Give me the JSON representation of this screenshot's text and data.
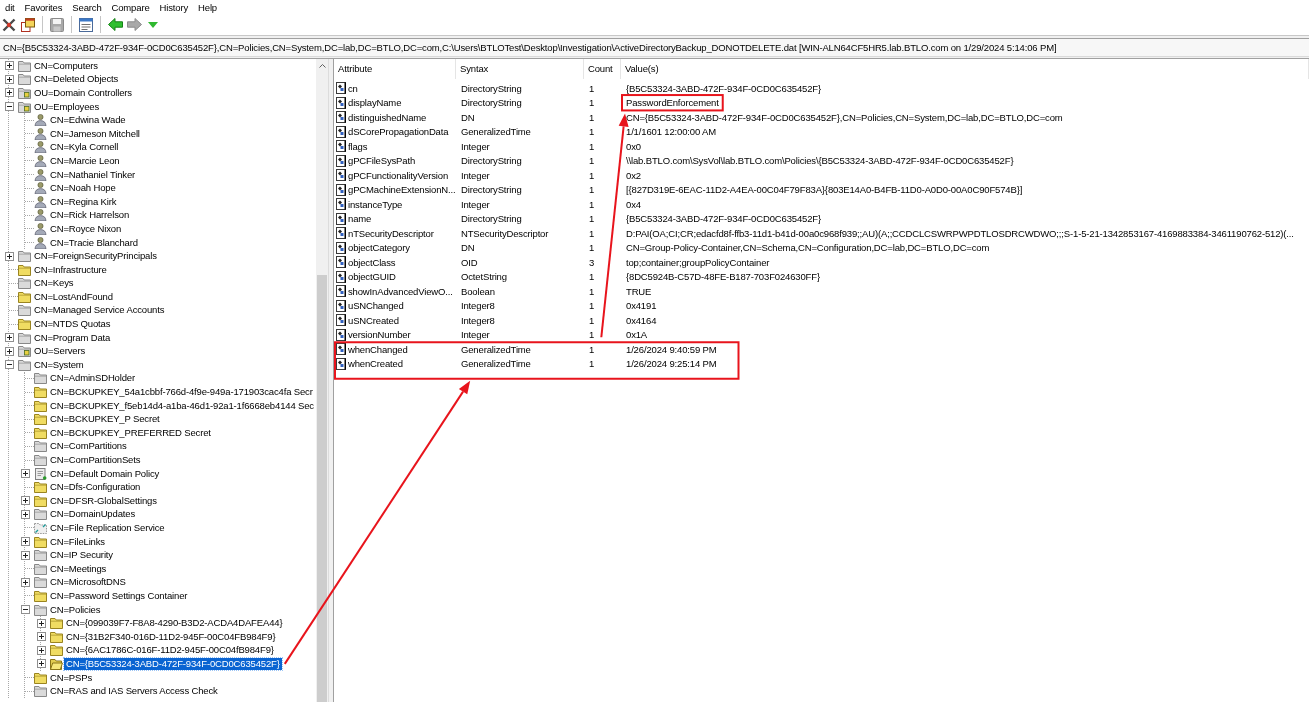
{
  "menu": [
    "dit",
    "Favorites",
    "Search",
    "Compare",
    "History",
    "Help"
  ],
  "toolbar": [
    [
      {
        "kind": "cross",
        "disabled": false
      },
      {
        "kind": "windows",
        "disabled": false
      }
    ],
    [
      {
        "kind": "save",
        "disabled": true
      }
    ],
    [
      {
        "kind": "properties",
        "disabled": false
      }
    ],
    [
      {
        "kind": "back",
        "disabled": false
      },
      {
        "kind": "forward",
        "disabled": true
      },
      {
        "kind": "history",
        "disabled": false
      }
    ]
  ],
  "path": "CN={B5C53324-3ABD-472F-934F-0CD0C635452F},CN=Policies,CN=System,DC=lab,DC=BTLO,DC=com,C:\\Users\\BTLOTest\\Desktop\\Investigation\\ActiveDirectoryBackup_DONOTDELETE.dat [WIN-ALN64CF5HR5.lab.BTLO.com on 1/29/2024 5:14:06 PM]",
  "tree": [
    {
      "label": "CN=Computers",
      "kind": "container",
      "expanded": false,
      "selected": false
    },
    {
      "label": "CN=Deleted Objects",
      "kind": "container",
      "expanded": false,
      "selected": false
    },
    {
      "label": "OU=Domain Controllers",
      "kind": "ou",
      "expanded": false,
      "selected": false
    },
    {
      "label": "OU=Employees",
      "kind": "ou",
      "expanded": true,
      "selected": false,
      "children": [
        {
          "label": "CN=Edwina Wade",
          "kind": "user",
          "selected": false
        },
        {
          "label": "CN=Jameson Mitchell",
          "kind": "user",
          "selected": false
        },
        {
          "label": "CN=Kyla Cornell",
          "kind": "user",
          "selected": false
        },
        {
          "label": "CN=Marcie Leon",
          "kind": "user",
          "selected": false
        },
        {
          "label": "CN=Nathaniel Tinker",
          "kind": "user",
          "selected": false
        },
        {
          "label": "CN=Noah Hope",
          "kind": "user",
          "selected": false
        },
        {
          "label": "CN=Regina Kirk",
          "kind": "user",
          "selected": false
        },
        {
          "label": "CN=Rick Harrelson",
          "kind": "user",
          "selected": false
        },
        {
          "label": "CN=Royce Nixon",
          "kind": "user",
          "selected": false
        },
        {
          "label": "CN=Tracie Blanchard",
          "kind": "user",
          "selected": false
        }
      ]
    },
    {
      "label": "CN=ForeignSecurityPrincipals",
      "kind": "container",
      "expanded": false,
      "selected": false
    },
    {
      "label": "CN=Infrastructure",
      "kind": "folder",
      "selected": false
    },
    {
      "label": "CN=Keys",
      "kind": "container",
      "selected": false
    },
    {
      "label": "CN=LostAndFound",
      "kind": "folder",
      "selected": false
    },
    {
      "label": "CN=Managed Service Accounts",
      "kind": "container",
      "selected": false
    },
    {
      "label": "CN=NTDS Quotas",
      "kind": "folder",
      "selected": false
    },
    {
      "label": "CN=Program Data",
      "kind": "container",
      "expanded": false,
      "selected": false
    },
    {
      "label": "OU=Servers",
      "kind": "ou",
      "expanded": false,
      "selected": false
    },
    {
      "label": "CN=System",
      "kind": "container",
      "expanded": true,
      "selected": false,
      "children": [
        {
          "label": "CN=AdminSDHolder",
          "kind": "container",
          "selected": false
        },
        {
          "label": "CN=BCKUPKEY_54a1cbbf-766d-4f9e-949a-171903cac4fa Secr",
          "kind": "folder",
          "selected": false
        },
        {
          "label": "CN=BCKUPKEY_f5eb14d4-a1ba-46d1-92a1-1f6668eb4144 Sec",
          "kind": "folder",
          "selected": false
        },
        {
          "label": "CN=BCKUPKEY_P Secret",
          "kind": "folder",
          "selected": false
        },
        {
          "label": "CN=BCKUPKEY_PREFERRED Secret",
          "kind": "folder",
          "selected": false
        },
        {
          "label": "CN=ComPartitions",
          "kind": "container",
          "selected": false
        },
        {
          "label": "CN=ComPartitionSets",
          "kind": "container",
          "selected": false
        },
        {
          "label": "CN=Default Domain Policy",
          "kind": "policy",
          "expanded": false,
          "selected": false
        },
        {
          "label": "CN=Dfs-Configuration",
          "kind": "folder",
          "selected": false
        },
        {
          "label": "CN=DFSR-GlobalSettings",
          "kind": "folder",
          "expanded": false,
          "selected": false
        },
        {
          "label": "CN=DomainUpdates",
          "kind": "container",
          "expanded": false,
          "selected": false
        },
        {
          "label": "CN=File Replication Service",
          "kind": "replication",
          "selected": false
        },
        {
          "label": "CN=FileLinks",
          "kind": "folder",
          "expanded": false,
          "selected": false
        },
        {
          "label": "CN=IP Security",
          "kind": "container",
          "expanded": false,
          "selected": false
        },
        {
          "label": "CN=Meetings",
          "kind": "container",
          "selected": false
        },
        {
          "label": "CN=MicrosoftDNS",
          "kind": "container",
          "expanded": false,
          "selected": false
        },
        {
          "label": "CN=Password Settings Container",
          "kind": "folder",
          "selected": false
        },
        {
          "label": "CN=Policies",
          "kind": "container",
          "expanded": true,
          "selected": false,
          "children": [
            {
              "label": "CN={099039F7-F8A8-4290-B3D2-ACDA4DAFEA44}",
              "kind": "folder",
              "expanded": false,
              "selected": false
            },
            {
              "label": "CN={31B2F340-016D-11D2-945F-00C04FB984F9}",
              "kind": "folder",
              "expanded": false,
              "selected": false
            },
            {
              "label": "CN={6AC1786C-016F-11D2-945F-00C04fB984F9}",
              "kind": "folder",
              "expanded": false,
              "selected": false
            },
            {
              "label": "CN={B5C53324-3ABD-472F-934F-0CD0C635452F}",
              "kind": "open_folder",
              "expanded": false,
              "selected": true
            }
          ]
        },
        {
          "label": "CN=PSPs",
          "kind": "folder",
          "selected": false
        },
        {
          "label": "CN=RAS and IAS Servers Access Check",
          "kind": "container",
          "selected": false
        }
      ]
    }
  ],
  "list": {
    "columns": [
      "Attribute",
      "Syntax",
      "Count",
      "Value(s)"
    ],
    "rows": [
      {
        "attribute": "cn",
        "syntax": "DirectoryString",
        "count": "1",
        "value": "{B5C53324-3ABD-472F-934F-0CD0C635452F}",
        "boxed": false,
        "value_boxed": false
      },
      {
        "attribute": "displayName",
        "syntax": "DirectoryString",
        "count": "1",
        "value": "PasswordEnforcement",
        "boxed": false,
        "value_boxed": true
      },
      {
        "attribute": "distinguishedName",
        "syntax": "DN",
        "count": "1",
        "value": "CN={B5C53324-3ABD-472F-934F-0CD0C635452F},CN=Policies,CN=System,DC=lab,DC=BTLO,DC=com",
        "boxed": false,
        "value_boxed": false
      },
      {
        "attribute": "dSCorePropagationData",
        "syntax": "GeneralizedTime",
        "count": "1",
        "value": "1/1/1601 12:00:00 AM",
        "boxed": false,
        "value_boxed": false
      },
      {
        "attribute": "flags",
        "syntax": "Integer",
        "count": "1",
        "value": "0x0",
        "boxed": false,
        "value_boxed": false
      },
      {
        "attribute": "gPCFileSysPath",
        "syntax": "DirectoryString",
        "count": "1",
        "value": "\\\\lab.BTLO.com\\SysVol\\lab.BTLO.com\\Policies\\{B5C53324-3ABD-472F-934F-0CD0C635452F}",
        "boxed": false,
        "value_boxed": false
      },
      {
        "attribute": "gPCFunctionalityVersion",
        "syntax": "Integer",
        "count": "1",
        "value": "0x2",
        "boxed": false,
        "value_boxed": false
      },
      {
        "attribute": "gPCMachineExtensionN...",
        "syntax": "DirectoryString",
        "count": "1",
        "value": "[{827D319E-6EAC-11D2-A4EA-00C04F79F83A}{803E14A0-B4FB-11D0-A0D0-00A0C90F574B}]",
        "boxed": false,
        "value_boxed": false
      },
      {
        "attribute": "instanceType",
        "syntax": "Integer",
        "count": "1",
        "value": "0x4",
        "boxed": false,
        "value_boxed": false
      },
      {
        "attribute": "name",
        "syntax": "DirectoryString",
        "count": "1",
        "value": "{B5C53324-3ABD-472F-934F-0CD0C635452F}",
        "boxed": false,
        "value_boxed": false
      },
      {
        "attribute": "nTSecurityDescriptor",
        "syntax": "NTSecurityDescriptor",
        "count": "1",
        "value": "D:PAI(OA;CI;CR;edacfd8f-ffb3-11d1-b41d-00a0c968f939;;AU)(A;;CCDCLCSWRPWPDTLOSDRCWDWO;;;S-1-5-21-1342853167-4169883384-3461190762-512)(...",
        "boxed": false,
        "value_boxed": false
      },
      {
        "attribute": "objectCategory",
        "syntax": "DN",
        "count": "1",
        "value": "CN=Group-Policy-Container,CN=Schema,CN=Configuration,DC=lab,DC=BTLO,DC=com",
        "boxed": false,
        "value_boxed": false
      },
      {
        "attribute": "objectClass",
        "syntax": "OID",
        "count": "3",
        "value": "top;container;groupPolicyContainer",
        "boxed": false,
        "value_boxed": false
      },
      {
        "attribute": "objectGUID",
        "syntax": "OctetString",
        "count": "1",
        "value": "{8DC5924B-C57D-48FE-B187-703F024630FF}",
        "boxed": false,
        "value_boxed": false
      },
      {
        "attribute": "showInAdvancedViewO...",
        "syntax": "Boolean",
        "count": "1",
        "value": "TRUE",
        "boxed": false,
        "value_boxed": false
      },
      {
        "attribute": "uSNChanged",
        "syntax": "Integer8",
        "count": "1",
        "value": "0x4191",
        "boxed": false,
        "value_boxed": false
      },
      {
        "attribute": "uSNCreated",
        "syntax": "Integer8",
        "count": "1",
        "value": "0x4164",
        "boxed": false,
        "value_boxed": false
      },
      {
        "attribute": "versionNumber",
        "syntax": "Integer",
        "count": "1",
        "value": "0x1A",
        "boxed": false,
        "value_boxed": false
      },
      {
        "attribute": "whenChanged",
        "syntax": "GeneralizedTime",
        "count": "1",
        "value": "1/26/2024 9:40:59 PM",
        "boxed": true,
        "value_boxed": false
      },
      {
        "attribute": "whenCreated",
        "syntax": "GeneralizedTime",
        "count": "1",
        "value": "1/26/2024 9:25:14 PM",
        "boxed": true,
        "value_boxed": false
      }
    ]
  },
  "annotations": {
    "arrow_from_selected_item": true,
    "arrow_from_boxed_rows": true
  }
}
